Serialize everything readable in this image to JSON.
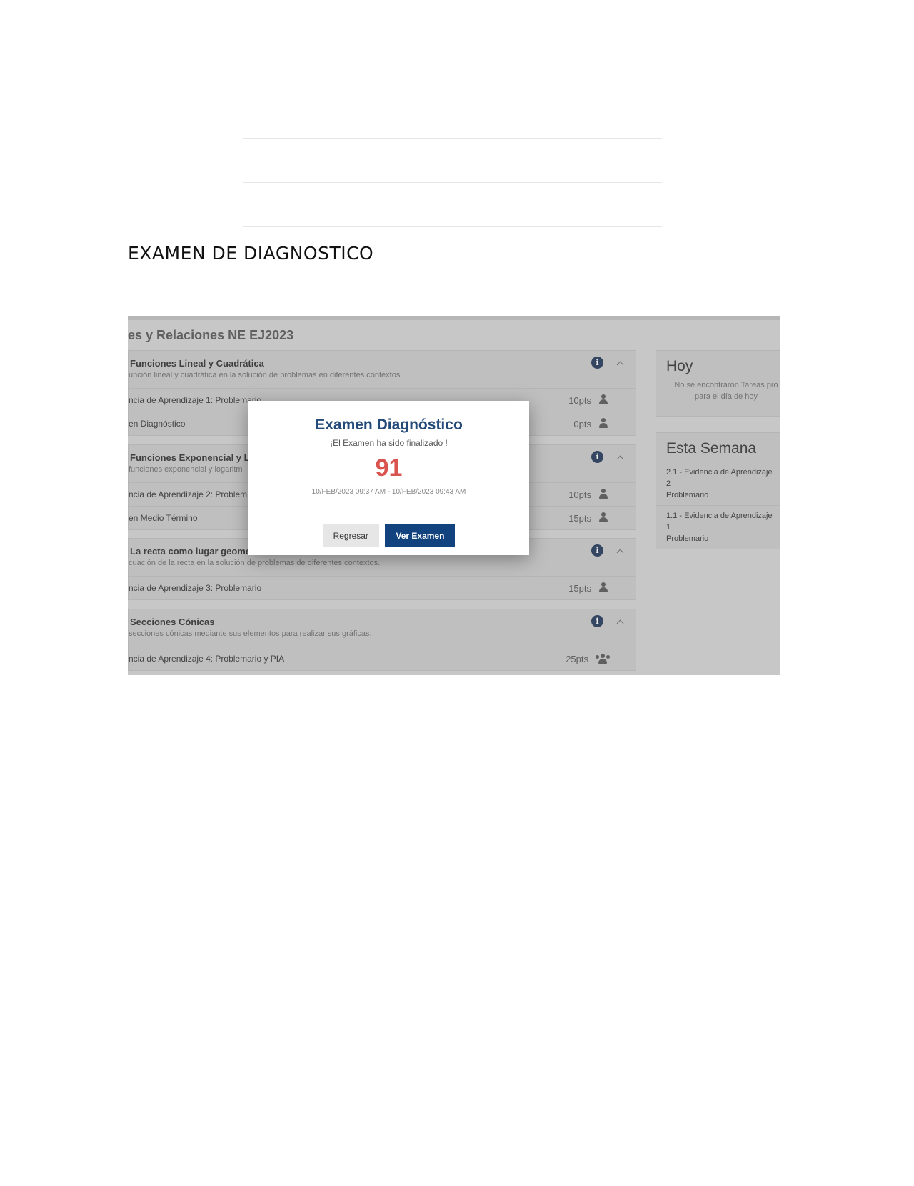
{
  "document": {
    "heading": "EXAMEN DE DIAGNOSTICO"
  },
  "app": {
    "course_title": "es y Relaciones NE EJ2023",
    "units": [
      {
        "title": "Funciones Lineal y Cuadrática",
        "desc": "unción lineal y cuadrática en la solución de problemas en diferentes contextos.",
        "items": [
          {
            "label": "ncia de Aprendizaje 1: Problemario",
            "pts": "10pts",
            "icon": "user-icon"
          },
          {
            "label": "en Diagnóstico",
            "pts": "0pts",
            "icon": "user-icon"
          }
        ]
      },
      {
        "title": "Funciones Exponencial y Log",
        "desc": "funciones exponencial y logaritm",
        "items": [
          {
            "label": "ncia de Aprendizaje 2: Problem",
            "pts": "10pts",
            "icon": "user-icon"
          },
          {
            "label": "en Medio Término",
            "pts": "15pts",
            "icon": "user-icon"
          }
        ]
      },
      {
        "title": "La recta como lugar geométi",
        "desc": "cuación de la recta en la solución de problemas de diferentes contextos.",
        "items": [
          {
            "label": "ncia de Aprendizaje 3: Problemario",
            "pts": "15pts",
            "icon": "user-icon"
          }
        ]
      },
      {
        "title": "Secciones Cónicas",
        "desc": "secciones cónicas mediante sus elementos para realizar sus gráficas.",
        "items": [
          {
            "label": "ncia de Aprendizaje 4: Problemario y PIA",
            "pts": "25pts",
            "icon": "users-icon"
          }
        ]
      }
    ],
    "today": {
      "title": "Hoy",
      "empty_text_line1": "No se encontraron Tareas pro",
      "empty_text_line2": "para el día de hoy"
    },
    "week": {
      "title": "Esta Semana",
      "items": [
        {
          "line1": "2.1 - Evidencia de Aprendizaje 2",
          "line2": "Problemario"
        },
        {
          "line1": "1.1 - Evidencia de Aprendizaje 1",
          "line2": "Problemario"
        }
      ]
    },
    "modal": {
      "title": "Examen Diagnóstico",
      "message": "¡El Examen ha sido finalizado !",
      "score": "91",
      "dates": "10/FEB/2023 09:37 AM - 10/FEB/2023 09:43 AM",
      "back_label": "Regresar",
      "view_label": "Ver Examen"
    },
    "colors": {
      "modal_title": "#244a7a",
      "score": "#d9534f",
      "primary_button": "#13437e"
    }
  }
}
